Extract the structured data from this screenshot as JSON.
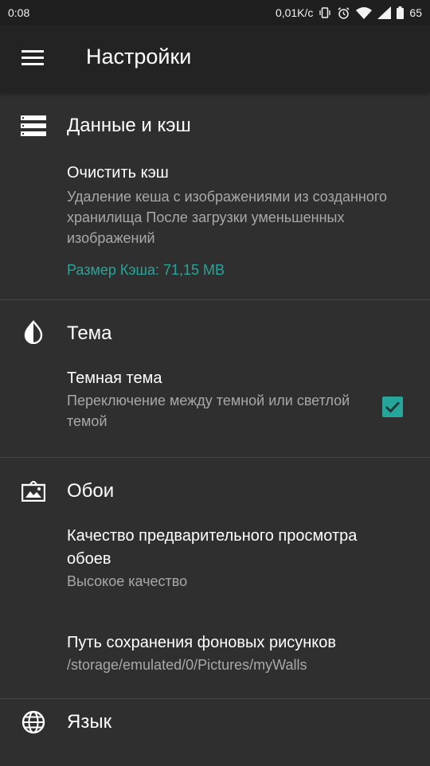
{
  "status_bar": {
    "time": "0:08",
    "network_speed": "0,01K/c",
    "battery_level": "65",
    "icons": [
      "vibrate-icon",
      "alarm-icon",
      "wifi-icon",
      "signal-icon",
      "battery-icon"
    ]
  },
  "app_bar": {
    "menu_icon": "menu-icon",
    "title": "Настройки"
  },
  "sections": {
    "data_cache": {
      "icon": "storage-icon",
      "title": "Данные и кэш",
      "clear_cache": {
        "title": "Очистить кэш",
        "summary": "Удаление кеша с изображениями из созданного хранилища После загрузки уменьшенных изображений",
        "cache_size": "Размер Кэша: 71,15 MB"
      }
    },
    "theme": {
      "icon": "theme-drop-icon",
      "title": "Тема",
      "dark_theme": {
        "title": "Темная тема",
        "summary": "Переключение между темной или светлой темой",
        "checked": true
      }
    },
    "wallpapers": {
      "icon": "wallpaper-icon",
      "title": "Обои",
      "preview_quality": {
        "title": "Качество предварительного просмотра обоев",
        "summary": "Высокое качество"
      },
      "save_path": {
        "title": "Путь сохранения фоновых рисунков",
        "summary": "/storage/emulated/0/Pictures/myWalls"
      }
    },
    "language": {
      "icon": "globe-icon",
      "title": "Язык"
    }
  },
  "colors": {
    "accent": "#26a69a",
    "background": "#2f2f2f",
    "app_bar": "#232323",
    "status_bar": "#1f1f1f",
    "secondary_text": "#a8a8a8"
  }
}
